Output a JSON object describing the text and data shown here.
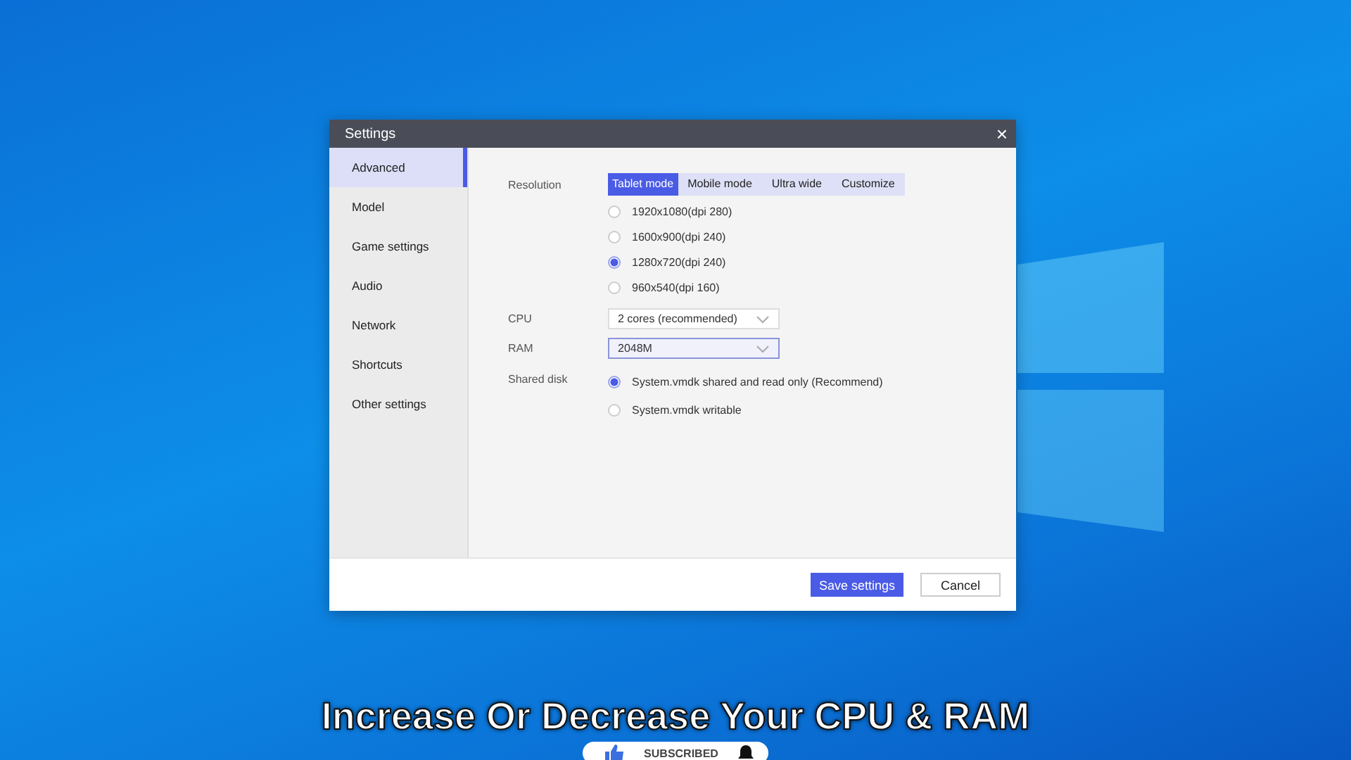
{
  "window": {
    "title": "Settings",
    "close": "×"
  },
  "sidebar": {
    "items": [
      {
        "label": "Advanced",
        "selected": true
      },
      {
        "label": "Model",
        "selected": false
      },
      {
        "label": "Game settings",
        "selected": false
      },
      {
        "label": "Audio",
        "selected": false
      },
      {
        "label": "Network",
        "selected": false
      },
      {
        "label": "Shortcuts",
        "selected": false
      },
      {
        "label": "Other settings",
        "selected": false
      }
    ]
  },
  "resolution": {
    "label": "Resolution",
    "tabs": [
      {
        "label": "Tablet mode",
        "selected": true
      },
      {
        "label": "Mobile mode",
        "selected": false
      },
      {
        "label": "Ultra wide",
        "selected": false
      },
      {
        "label": "Customize",
        "selected": false
      }
    ],
    "options": [
      {
        "label": "1920x1080(dpi 280)",
        "selected": false
      },
      {
        "label": "1600x900(dpi 240)",
        "selected": false
      },
      {
        "label": "1280x720(dpi 240)",
        "selected": true
      },
      {
        "label": "960x540(dpi 160)",
        "selected": false
      }
    ]
  },
  "cpu": {
    "label": "CPU",
    "value": "2 cores (recommended)"
  },
  "ram": {
    "label": "RAM",
    "value": "2048M",
    "focused": true
  },
  "shared_disk": {
    "label": "Shared disk",
    "options": [
      {
        "label": "System.vmdk shared and read only (Recommend)",
        "selected": true
      },
      {
        "label": "System.vmdk writable",
        "selected": false
      }
    ]
  },
  "buttons": {
    "save": "Save settings",
    "cancel": "Cancel"
  },
  "caption": "Increase Or Decrease Your CPU & RAM",
  "subscribe": {
    "label": "SUBSCRIBED"
  }
}
